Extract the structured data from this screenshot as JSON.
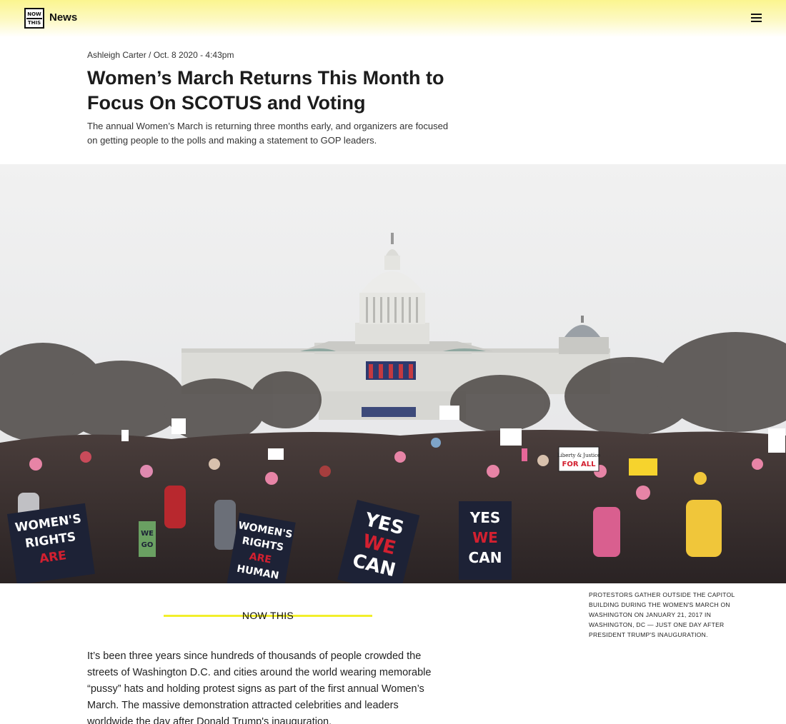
{
  "header": {
    "logo_top": "NOW",
    "logo_bottom": "THIS",
    "brand": "News",
    "menu_icon": "hamburger-menu-icon"
  },
  "article": {
    "byline": "Ashleigh Carter / Oct. 8 2020 - 4:43pm",
    "headline": "Women’s March Returns This Month to Focus On SCOTUS and Voting",
    "dek": "The annual Women’s March is returning three months early, and organizers are focused on getting people to the polls and making a statement to GOP leaders.",
    "image_caption": "PROTESTORS GATHER OUTSIDE THE CAPITOL BUILDING DURING THE WOMEN'S MARCH ON WASHINGTON ON JANUARY 21, 2017 IN WASHINGTON, DC — JUST ONE DAY AFTER PRESIDENT TRUMP'S INAUGURATION.",
    "brand_divider": "NOW THIS",
    "body": "It’s been three years since hundreds of thousands of people crowded the streets of Washington D.C. and cities around the world wearing memorable “pussy” hats and holding protest signs as part of the first annual Women’s March. The massive demonstration attracted celebrities and leaders worldwide the day after Donald Trump's inauguration."
  },
  "photo_signs": {
    "sign_left_1": "WOMEN'S",
    "sign_left_2": "RIGHTS",
    "sign_left_3": "ARE",
    "sign_mid_1": "WOMEN'S",
    "sign_mid_2": "RIGHTS",
    "sign_mid_3": "ARE",
    "sign_mid_4": "HUMAN",
    "sign_yes_1": "YES",
    "sign_yes_2": "WE",
    "sign_yes_3": "CAN",
    "sign_yes2_1": "YES",
    "sign_yes2_2": "WE",
    "sign_yes2_3": "CAN",
    "sign_small_1": "WE",
    "sign_small_2": "GO",
    "sign_liberty_1": "Liberty & Justice",
    "sign_liberty_2": "FOR ALL"
  },
  "colors": {
    "accent_yellow": "#f2ef2b",
    "header_yellow": "#fbf58f",
    "sign_red": "#d32030",
    "sign_navy": "#1d2236"
  }
}
